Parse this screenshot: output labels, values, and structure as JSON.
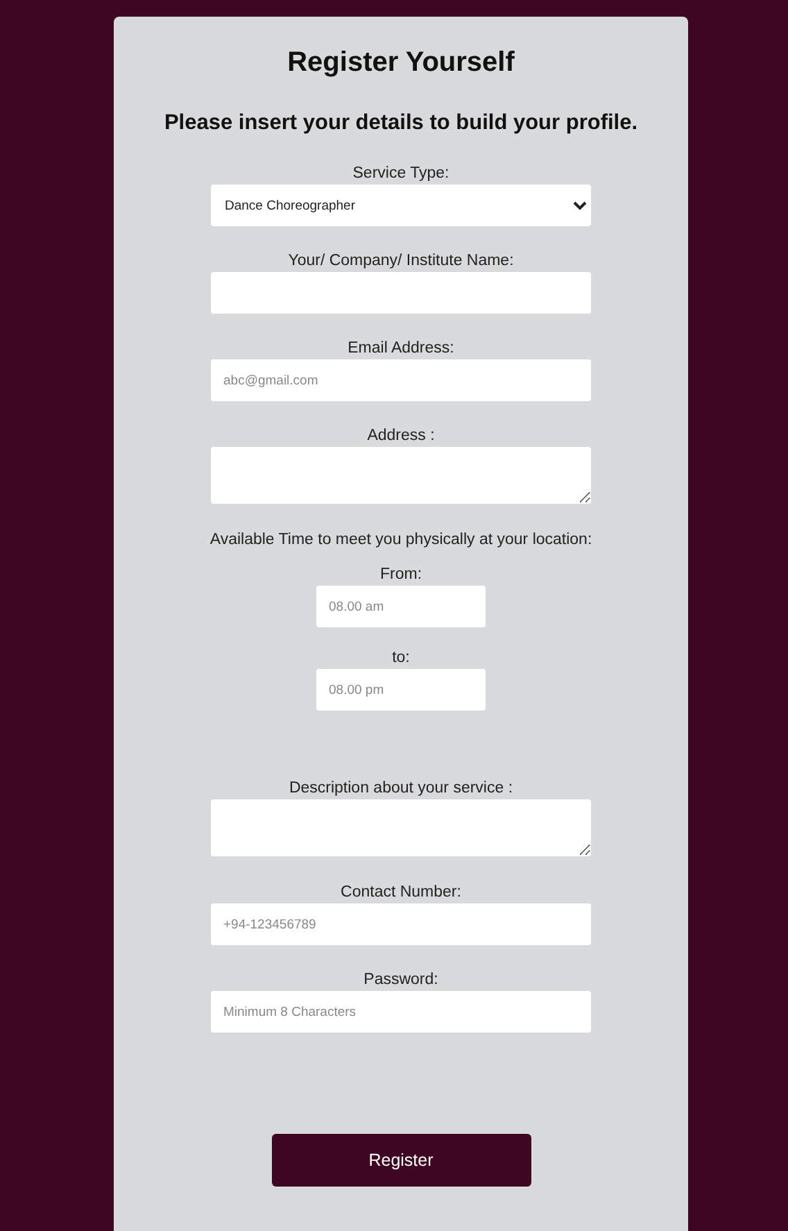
{
  "title": "Register Yourself",
  "subtitle": "Please insert your details to build your profile.",
  "fields": [
    {
      "kind": "select",
      "label": "Service Type:",
      "value": "Dance Choreographer"
    },
    {
      "kind": "text",
      "label": "Your/ Company/ Institute Name:"
    },
    {
      "kind": "text",
      "label": "Email Address:",
      "placeholder": "abc@gmail.com"
    },
    {
      "kind": "textarea",
      "label": "Address :"
    },
    {
      "kind": "note",
      "label": "Available Time to meet you physically at your location:"
    },
    {
      "kind": "time",
      "label": "From:",
      "placeholder": "08.00 am"
    },
    {
      "kind": "time",
      "label": "to:",
      "placeholder": "08.00 pm"
    },
    {
      "kind": "textarea",
      "label": "Description about your service :"
    },
    {
      "kind": "text",
      "label": "Contact Number:",
      "placeholder": "+94-123456789"
    },
    {
      "kind": "text",
      "label": "Password:",
      "placeholder": "Minimum 8 Characters"
    }
  ],
  "button": "Register"
}
